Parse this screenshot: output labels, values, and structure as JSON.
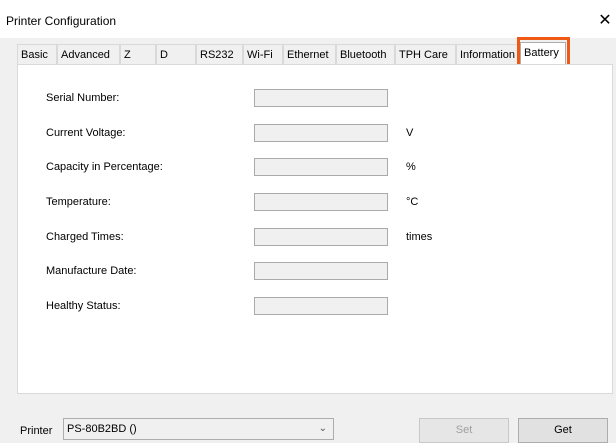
{
  "window": {
    "title": "Printer Configuration",
    "close_glyph": "✕"
  },
  "tabs": [
    {
      "label": "Basic"
    },
    {
      "label": "Advanced"
    },
    {
      "label": "Z"
    },
    {
      "label": "D"
    },
    {
      "label": "RS232"
    },
    {
      "label": "Wi-Fi"
    },
    {
      "label": "Ethernet"
    },
    {
      "label": "Bluetooth"
    },
    {
      "label": "TPH Care"
    },
    {
      "label": "Information"
    },
    {
      "label": "Battery",
      "active": true
    }
  ],
  "battery": {
    "rows": [
      {
        "label": "Serial Number:",
        "value": "",
        "unit": ""
      },
      {
        "label": "Current Voltage:",
        "value": "",
        "unit": "V"
      },
      {
        "label": "Capacity in Percentage:",
        "value": "",
        "unit": "%"
      },
      {
        "label": "Temperature:",
        "value": "",
        "unit": "°C"
      },
      {
        "label": "Charged Times:",
        "value": "",
        "unit": "times"
      },
      {
        "label": "Manufacture Date:",
        "value": "",
        "unit": ""
      },
      {
        "label": "Healthy Status:",
        "value": "",
        "unit": ""
      }
    ]
  },
  "footer": {
    "printer_label": "Printer",
    "printer_value": "PS-80B2BD ()",
    "set_label": "Set",
    "get_label": "Get"
  },
  "colors": {
    "highlight": "#ee5a16"
  }
}
